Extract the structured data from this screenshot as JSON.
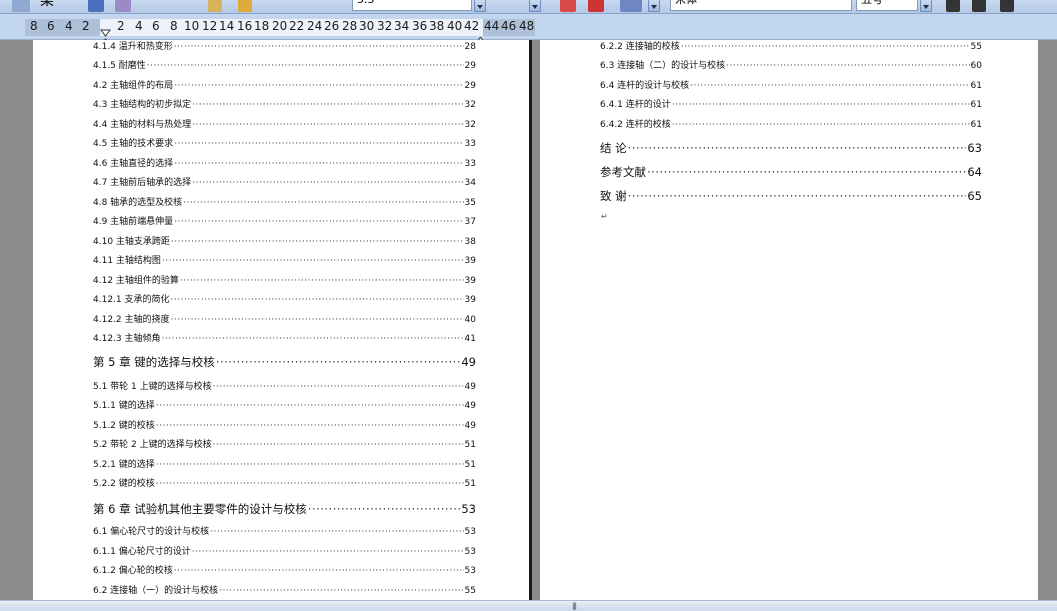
{
  "toolbar": {
    "font_size_value": "5.5",
    "font_name_value": "宋体",
    "char_size_value": "五号",
    "menu_fragment": "柔"
  },
  "ruler": {
    "left_numbers": [
      "8",
      "6",
      "4",
      "2"
    ],
    "right_numbers": [
      "2",
      "4",
      "6",
      "8",
      "10",
      "12",
      "14",
      "16",
      "18",
      "20",
      "22",
      "24",
      "26",
      "28",
      "30",
      "32",
      "34",
      "36",
      "38",
      "40",
      "42"
    ],
    "margin_numbers": [
      "44",
      "46",
      "48"
    ]
  },
  "left_page": {
    "entries": [
      {
        "label": "4.1.4   温升和热变形",
        "page": "28",
        "big": false
      },
      {
        "label": "4.1.5   耐磨性",
        "page": "29",
        "big": false
      },
      {
        "label": "4.2  主轴组件的布局",
        "page": "29",
        "big": false
      },
      {
        "label": "4.3  主轴结构的初步拟定",
        "page": "32",
        "big": false
      },
      {
        "label": "4.4  主轴的材料与热处理",
        "page": "32",
        "big": false
      },
      {
        "label": "4.5  主轴的技术要求",
        "page": "33",
        "big": false
      },
      {
        "label": "4.6    主轴直径的选择",
        "page": "33",
        "big": false
      },
      {
        "label": "4.7  主轴前后轴承的选择",
        "page": "34",
        "big": false
      },
      {
        "label": "4.8    轴承的选型及校核",
        "page": "35",
        "big": false
      },
      {
        "label": "4.9    主轴前端悬伸量",
        "page": "37",
        "big": false
      },
      {
        "label": "4.10    主轴支承跨距",
        "page": "38",
        "big": false
      },
      {
        "label": "4.11    主轴结构图",
        "page": "39",
        "big": false
      },
      {
        "label": "4.12    主轴组件的验算",
        "page": "39",
        "big": false
      },
      {
        "label": "4.12.1    支承的简化",
        "page": "39",
        "big": false
      },
      {
        "label": "4.12.2    主轴的挠度",
        "page": "40",
        "big": false
      },
      {
        "label": "4.12.3    主轴倾角",
        "page": "41",
        "big": false
      },
      {
        "label": "第 5 章    键的选择与校核",
        "page": "49",
        "big": true
      },
      {
        "label": "5.1  带轮 1 上键的选择与校核",
        "page": "49",
        "big": false
      },
      {
        "label": "5.1.1  键的选择",
        "page": "49",
        "big": false
      },
      {
        "label": "5.1.2  键的校核",
        "page": "49",
        "big": false
      },
      {
        "label": "5.2  带轮 2 上键的选择与校核",
        "page": "51",
        "big": false
      },
      {
        "label": "5.2.1  键的选择",
        "page": "51",
        "big": false
      },
      {
        "label": "5.2.2  键的校核",
        "page": "51",
        "big": false
      },
      {
        "label": "第 6 章    试验机其他主要零件的设计与校核",
        "page": "53",
        "big": true
      },
      {
        "label": "6.1    偏心轮尺寸的设计与校核",
        "page": "53",
        "big": false
      },
      {
        "label": "6.1.1    偏心轮尺寸的设计",
        "page": "53",
        "big": false
      },
      {
        "label": "6.1.2    偏心轮的校核",
        "page": "53",
        "big": false
      },
      {
        "label": "6.2    连接轴（一）的设计与校核",
        "page": "55",
        "big": false
      }
    ]
  },
  "right_page": {
    "entries": [
      {
        "label": "6.2.2    连接轴的校核",
        "page": "55",
        "big": false
      },
      {
        "label": "6.3    连接轴（二）的设计与校核",
        "page": "60",
        "big": false
      },
      {
        "label": "6.4    连杆的设计与校核",
        "page": "61",
        "big": false
      },
      {
        "label": "6.4.1    连杆的设计",
        "page": "61",
        "big": false
      },
      {
        "label": "6.4.2    连杆的校核",
        "page": "61",
        "big": false
      },
      {
        "label": "结  论",
        "page": "63",
        "big": true
      },
      {
        "label": "参考文献",
        "page": "64",
        "big": true
      },
      {
        "label": "致    谢",
        "page": "65",
        "big": true
      }
    ],
    "trailing_mark": "↵"
  },
  "scrollbar": {
    "grip": "|||"
  }
}
